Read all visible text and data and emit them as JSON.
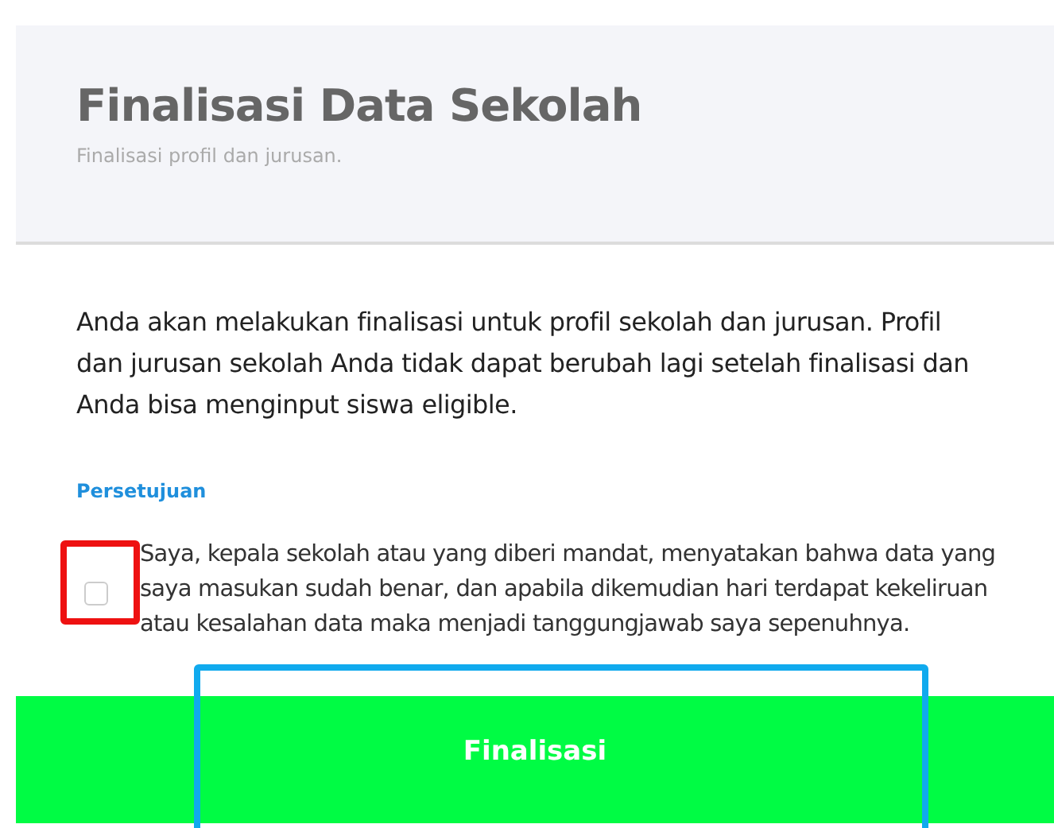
{
  "header": {
    "title": "Finalisasi Data Sekolah",
    "subtitle": "Finalisasi profil dan jurusan."
  },
  "intro": "Anda akan melakukan finalisasi untuk profil sekolah dan jurusan. Profil dan jurusan sekolah Anda tidak dapat berubah lagi setelah finalisasi dan Anda bisa menginput siswa eligible.",
  "agreement": {
    "label": "Persetujuan",
    "checked": false,
    "text": "Saya, kepala sekolah atau yang diberi mandat, menyatakan bahwa data yang saya masukan sudah benar, dan apabila dikemudian hari terdapat kekeliruan atau kesalahan data maka menjadi tanggungjawab saya sepenuhnya."
  },
  "submit": {
    "label": "Finalisasi"
  },
  "annotations": [
    {
      "kind": "checkbox",
      "color": "#ee1111"
    },
    {
      "kind": "button",
      "color": "#10aaee"
    }
  ]
}
